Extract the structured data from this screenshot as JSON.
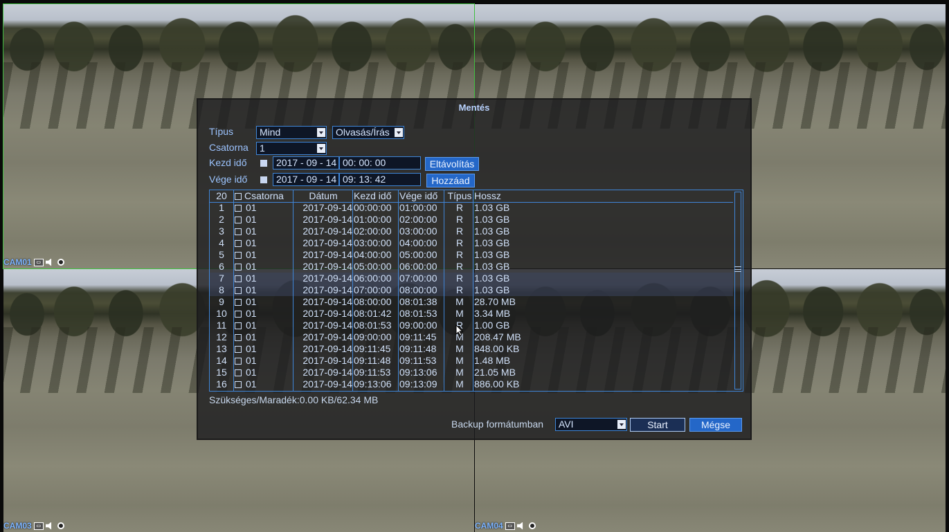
{
  "cameras": [
    {
      "id": "cam1",
      "label": "CAM01"
    },
    {
      "id": "cam2",
      "label": ""
    },
    {
      "id": "cam3",
      "label": "CAM03"
    },
    {
      "id": "cam4",
      "label": "CAM04"
    }
  ],
  "dialog": {
    "title": "Mentés",
    "type_label": "Típus",
    "type_value": "Mind",
    "mode_value": "Olvasás/Írás",
    "channel_label": "Csatorna",
    "channel_value": "1",
    "start_label": "Kezd idő",
    "start_date": "2017 - 09 - 14",
    "start_time": "00: 00: 00",
    "end_label": "Vége idő",
    "end_date": "2017 - 09 - 14",
    "end_time": "09: 13: 42",
    "remove_button": "Eltávolítás",
    "add_button": "Hozzáad",
    "table": {
      "count": "20",
      "headers": {
        "channel": "Csatorna",
        "date": "Dátum",
        "start": "Kezd idő",
        "end": "Vége idő",
        "type": "Típus",
        "length": "Hossz"
      },
      "rows": [
        {
          "idx": "1",
          "ch": "01",
          "date": "2017-09-14",
          "start": "00:00:00",
          "end": "01:00:00",
          "type": "R",
          "len": "1.03 GB"
        },
        {
          "idx": "2",
          "ch": "01",
          "date": "2017-09-14",
          "start": "01:00:00",
          "end": "02:00:00",
          "type": "R",
          "len": "1.03 GB"
        },
        {
          "idx": "3",
          "ch": "01",
          "date": "2017-09-14",
          "start": "02:00:00",
          "end": "03:00:00",
          "type": "R",
          "len": "1.03 GB"
        },
        {
          "idx": "4",
          "ch": "01",
          "date": "2017-09-14",
          "start": "03:00:00",
          "end": "04:00:00",
          "type": "R",
          "len": "1.03 GB"
        },
        {
          "idx": "5",
          "ch": "01",
          "date": "2017-09-14",
          "start": "04:00:00",
          "end": "05:00:00",
          "type": "R",
          "len": "1.03 GB"
        },
        {
          "idx": "6",
          "ch": "01",
          "date": "2017-09-14",
          "start": "05:00:00",
          "end": "06:00:00",
          "type": "R",
          "len": "1.03 GB"
        },
        {
          "idx": "7",
          "ch": "01",
          "date": "2017-09-14",
          "start": "06:00:00",
          "end": "07:00:00",
          "type": "R",
          "len": "1.03 GB"
        },
        {
          "idx": "8",
          "ch": "01",
          "date": "2017-09-14",
          "start": "07:00:00",
          "end": "08:00:00",
          "type": "R",
          "len": "1.03 GB"
        },
        {
          "idx": "9",
          "ch": "01",
          "date": "2017-09-14",
          "start": "08:00:00",
          "end": "08:01:38",
          "type": "M",
          "len": "28.70 MB"
        },
        {
          "idx": "10",
          "ch": "01",
          "date": "2017-09-14",
          "start": "08:01:42",
          "end": "08:01:53",
          "type": "M",
          "len": "3.34 MB"
        },
        {
          "idx": "11",
          "ch": "01",
          "date": "2017-09-14",
          "start": "08:01:53",
          "end": "09:00:00",
          "type": "R",
          "len": "1.00 GB"
        },
        {
          "idx": "12",
          "ch": "01",
          "date": "2017-09-14",
          "start": "09:00:00",
          "end": "09:11:45",
          "type": "M",
          "len": "208.47 MB"
        },
        {
          "idx": "13",
          "ch": "01",
          "date": "2017-09-14",
          "start": "09:11:45",
          "end": "09:11:48",
          "type": "M",
          "len": "848.00 KB"
        },
        {
          "idx": "14",
          "ch": "01",
          "date": "2017-09-14",
          "start": "09:11:48",
          "end": "09:11:53",
          "type": "M",
          "len": "1.48 MB"
        },
        {
          "idx": "15",
          "ch": "01",
          "date": "2017-09-14",
          "start": "09:11:53",
          "end": "09:13:06",
          "type": "M",
          "len": "21.05 MB"
        },
        {
          "idx": "16",
          "ch": "01",
          "date": "2017-09-14",
          "start": "09:13:06",
          "end": "09:13:09",
          "type": "M",
          "len": "886.00 KB"
        }
      ]
    },
    "space_text": "Szükséges/Maradék:0.00 KB/62.34 MB",
    "format_label": "Backup formátumban",
    "format_value": "AVI",
    "start_button": "Start",
    "cancel_button": "Mégse"
  }
}
